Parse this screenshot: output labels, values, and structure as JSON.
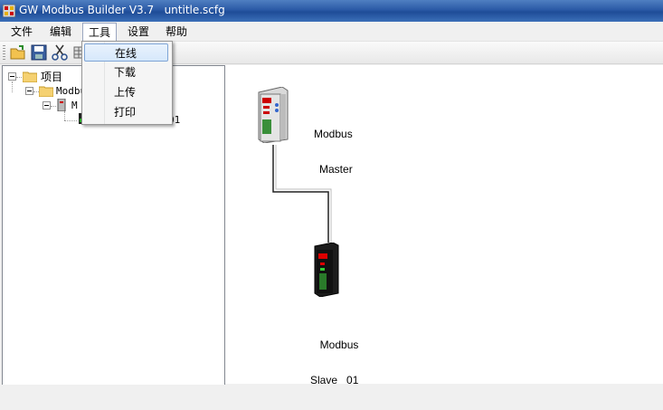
{
  "window": {
    "title": "GW Modbus Builder V3.7   untitle.scfg"
  },
  "menubar": {
    "items": [
      {
        "label": "文件"
      },
      {
        "label": "编辑"
      },
      {
        "label": "工具"
      },
      {
        "label": "设置"
      },
      {
        "label": "帮助"
      }
    ]
  },
  "tools_menu": {
    "items": [
      {
        "label": "在线",
        "highlighted": true
      },
      {
        "label": "下载"
      },
      {
        "label": "上传"
      },
      {
        "label": "打印"
      }
    ]
  },
  "toolbar": {
    "buttons": [
      "open-folder-icon",
      "save-icon",
      "cut-icon",
      "grid-icon",
      "paste-icon"
    ]
  },
  "tree": {
    "root": {
      "label": "项目"
    },
    "node1": {
      "label": "Modbu"
    },
    "node2": {
      "label": "M"
    },
    "node3": {
      "label": "01"
    }
  },
  "canvas": {
    "master": {
      "line1": "Modbus",
      "line2": "Master"
    },
    "slave": {
      "line1": "Modbus",
      "line2": "Slave   01"
    }
  },
  "colors": {
    "titlebar": "#2b5aa6",
    "menu_highlight": "#d6e8fb"
  }
}
